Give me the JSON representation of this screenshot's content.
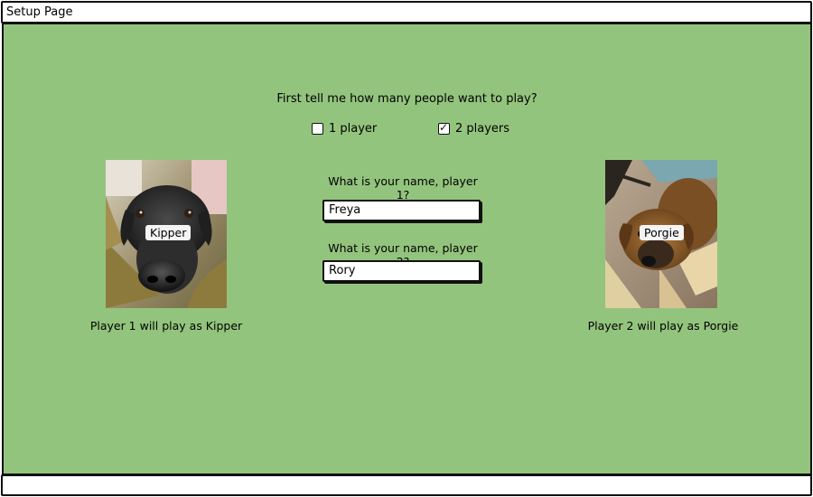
{
  "window": {
    "title": "Setup Page"
  },
  "player_count": {
    "prompt": "First tell me how many people want to play?",
    "options": [
      {
        "label": "1 player",
        "checked": false
      },
      {
        "label": "2 players",
        "checked": true
      }
    ]
  },
  "names": {
    "player1_question": "What is your name, player 1?",
    "player1_value": "Freya",
    "player2_question": "What is your name, player 2?",
    "player2_value": "Rory"
  },
  "players": [
    {
      "dog_name": "Kipper",
      "caption": "Player 1 will play as Kipper"
    },
    {
      "dog_name": "Porgie",
      "caption": "Player 2 will play as Porgie"
    }
  ],
  "colors": {
    "canvas_background": "#93c47d",
    "border": "#111111"
  }
}
